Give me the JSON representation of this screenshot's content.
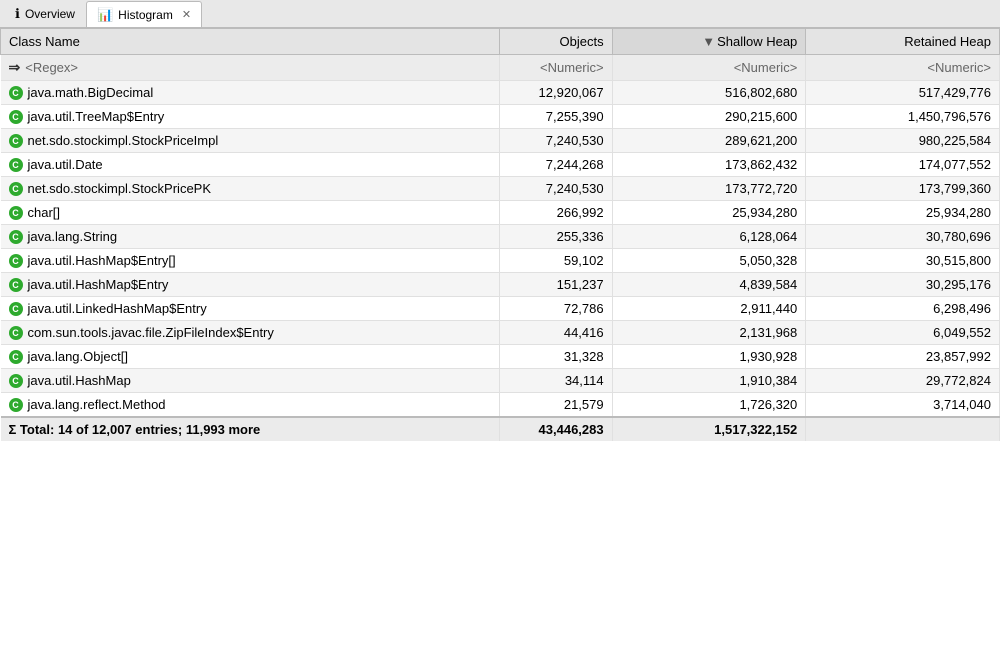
{
  "tabs": [
    {
      "id": "overview",
      "label": "Overview",
      "icon": "ℹ",
      "active": false,
      "closeable": false
    },
    {
      "id": "histogram",
      "label": "Histogram",
      "icon": "📊",
      "active": true,
      "closeable": true
    }
  ],
  "table": {
    "columns": [
      {
        "id": "classname",
        "label": "Class Name",
        "sorted": false
      },
      {
        "id": "objects",
        "label": "Objects",
        "sorted": false
      },
      {
        "id": "shallow",
        "label": "Shallow Heap",
        "sorted": true,
        "sortDir": "desc"
      },
      {
        "id": "retained",
        "label": "Retained Heap",
        "sorted": false
      }
    ],
    "filter_row": {
      "classname": "<Regex>",
      "objects": "<Numeric>",
      "shallow": "<Numeric>",
      "retained": "<Numeric>"
    },
    "rows": [
      {
        "classname": "java.math.BigDecimal",
        "objects": "12,920,067",
        "shallow": "516,802,680",
        "retained": "517,429,776"
      },
      {
        "classname": "java.util.TreeMap$Entry",
        "objects": "7,255,390",
        "shallow": "290,215,600",
        "retained": "1,450,796,576"
      },
      {
        "classname": "net.sdo.stockimpl.StockPriceImpl",
        "objects": "7,240,530",
        "shallow": "289,621,200",
        "retained": "980,225,584"
      },
      {
        "classname": "java.util.Date",
        "objects": "7,244,268",
        "shallow": "173,862,432",
        "retained": "174,077,552"
      },
      {
        "classname": "net.sdo.stockimpl.StockPricePK",
        "objects": "7,240,530",
        "shallow": "173,772,720",
        "retained": "173,799,360"
      },
      {
        "classname": "char[]",
        "objects": "266,992",
        "shallow": "25,934,280",
        "retained": "25,934,280"
      },
      {
        "classname": "java.lang.String",
        "objects": "255,336",
        "shallow": "6,128,064",
        "retained": "30,780,696"
      },
      {
        "classname": "java.util.HashMap$Entry[]",
        "objects": "59,102",
        "shallow": "5,050,328",
        "retained": "30,515,800"
      },
      {
        "classname": "java.util.HashMap$Entry",
        "objects": "151,237",
        "shallow": "4,839,584",
        "retained": "30,295,176"
      },
      {
        "classname": "java.util.LinkedHashMap$Entry",
        "objects": "72,786",
        "shallow": "2,911,440",
        "retained": "6,298,496"
      },
      {
        "classname": "com.sun.tools.javac.file.ZipFileIndex$Entry",
        "objects": "44,416",
        "shallow": "2,131,968",
        "retained": "6,049,552"
      },
      {
        "classname": "java.lang.Object[]",
        "objects": "31,328",
        "shallow": "1,930,928",
        "retained": "23,857,992"
      },
      {
        "classname": "java.util.HashMap",
        "objects": "34,114",
        "shallow": "1,910,384",
        "retained": "29,772,824"
      },
      {
        "classname": "java.lang.reflect.Method",
        "objects": "21,579",
        "shallow": "1,726,320",
        "retained": "3,714,040"
      }
    ],
    "footer": {
      "label": "Σ Total: 14 of 12,007 entries; 11,993 more",
      "objects": "43,446,283",
      "shallow": "1,517,322,152",
      "retained": ""
    }
  }
}
